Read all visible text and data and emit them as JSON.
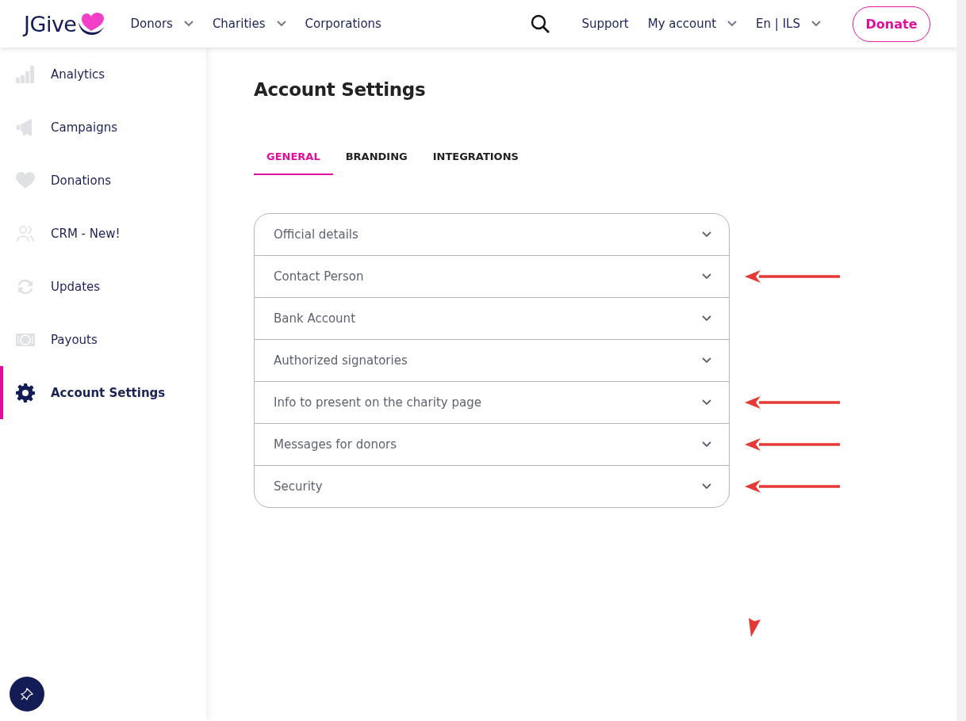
{
  "header": {
    "logo": "JGive",
    "nav": [
      {
        "label": "Donors",
        "dropdown": true
      },
      {
        "label": "Charities",
        "dropdown": true
      },
      {
        "label": "Corporations",
        "dropdown": false
      }
    ],
    "right_nav": [
      {
        "label": "Support",
        "dropdown": false
      },
      {
        "label": "My account",
        "dropdown": true
      },
      {
        "label": "En | ILS",
        "dropdown": true
      }
    ],
    "donate_button": "Donate"
  },
  "sidebar": {
    "items": [
      {
        "label": "Analytics",
        "kind": "bars",
        "selected": false
      },
      {
        "label": "Campaigns",
        "kind": "megaphone",
        "selected": false
      },
      {
        "label": "Donations",
        "kind": "heart",
        "selected": false
      },
      {
        "label": "CRM - New!",
        "kind": "people",
        "selected": false
      },
      {
        "label": "Updates",
        "kind": "refresh",
        "selected": false
      },
      {
        "label": "Payouts",
        "kind": "money",
        "selected": false
      },
      {
        "label": "Account Settings",
        "kind": "gear",
        "selected": true
      }
    ]
  },
  "page_title": "Account Settings",
  "tabs": [
    {
      "label": "GENERAL",
      "selected": true
    },
    {
      "label": "BRANDING",
      "selected": false
    },
    {
      "label": "INTEGRATIONS",
      "selected": false
    }
  ],
  "sections": [
    {
      "label": "Official details",
      "expanded": false,
      "annotated": false
    },
    {
      "label": "Contact Person",
      "expanded": false,
      "annotated": true
    },
    {
      "label": "Bank Account",
      "expanded": false,
      "annotated": false
    },
    {
      "label": "Authorized signatories",
      "expanded": false,
      "annotated": false
    },
    {
      "label": "Info to present on the charity page",
      "expanded": false,
      "annotated": true
    },
    {
      "label": "Messages for donors",
      "expanded": false,
      "annotated": true
    },
    {
      "label": "Security",
      "expanded": false,
      "annotated": true
    }
  ],
  "stray_arrowhead": true
}
